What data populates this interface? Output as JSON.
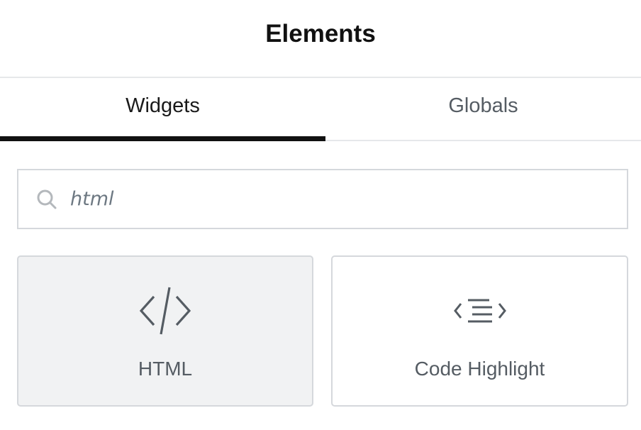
{
  "header": {
    "title": "Elements"
  },
  "tabs": [
    {
      "label": "Widgets",
      "active": true
    },
    {
      "label": "Globals",
      "active": false
    }
  ],
  "search": {
    "value": "html",
    "icon": "search-icon"
  },
  "widgets": [
    {
      "label": "HTML",
      "icon": "code-icon",
      "hovered": true
    },
    {
      "label": "Code Highlight",
      "icon": "code-highlight-icon",
      "hovered": false
    }
  ],
  "colors": {
    "accent": "#111111",
    "text_muted": "#555c63",
    "border": "#d5d8dc",
    "hover_bg": "#f1f2f3"
  }
}
